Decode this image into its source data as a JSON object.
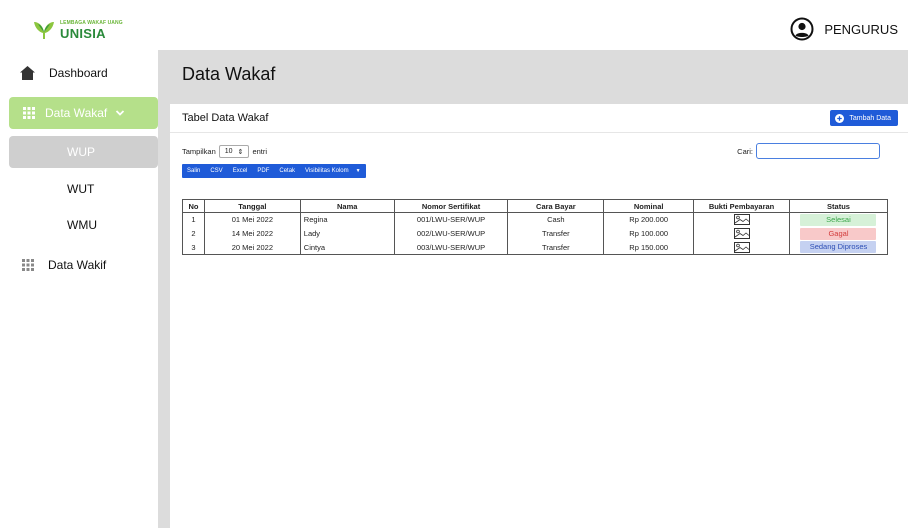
{
  "brand": {
    "line1": "LEMBAGA WAKAF UANG",
    "line2": "UNISIA"
  },
  "header": {
    "user_label": "PENGURUS"
  },
  "sidebar": {
    "items": [
      {
        "label": "Dashboard",
        "icon": "home-icon"
      },
      {
        "label": "Data Wakaf",
        "icon": "grid-icon"
      },
      {
        "label": "WUP"
      },
      {
        "label": "WUT"
      },
      {
        "label": "WMU"
      },
      {
        "label": "Data Wakif",
        "icon": "grid-icon"
      }
    ]
  },
  "main": {
    "page_title": "Data Wakaf",
    "card_title": "Tabel Data Wakaf",
    "add_button": "Tambah Data",
    "length": {
      "prefix": "Tampilkan",
      "value": "10",
      "suffix": "entri"
    },
    "search": {
      "label": "Cari:",
      "value": ""
    },
    "export_buttons": [
      "Salin",
      "CSV",
      "Excel",
      "PDF",
      "Cetak",
      "Visibilitas Kolom"
    ]
  },
  "table": {
    "headers": [
      "No",
      "Tanggal",
      "Nama",
      "Nomor Sertifikat",
      "Cara Bayar",
      "Nominal",
      "Bukti Pembayaran",
      "Status"
    ],
    "rows": [
      {
        "no": "1",
        "tanggal": "01 Mei 2022",
        "nama": "Regina",
        "nomor": "001/LWU-SER/WUP",
        "cara": "Cash",
        "nominal": "Rp 200.000",
        "status": "Selesai"
      },
      {
        "no": "2",
        "tanggal": "14 Mei 2022",
        "nama": "Lady",
        "nomor": "002/LWU-SER/WUP",
        "cara": "Transfer",
        "nominal": "Rp 100.000",
        "status": "Gagal"
      },
      {
        "no": "3",
        "tanggal": "20 Mei 2022",
        "nama": "Cintya",
        "nomor": "003/LWU-SER/WUP",
        "cara": "Transfer",
        "nominal": "Rp 150.000",
        "status": "Sedang Diproses"
      }
    ]
  },
  "colors": {
    "accent": "#1f5bd8",
    "sidebar_active": "#b5e08a",
    "sidebar_selected": "#cfcfcf",
    "status_done": "#3aa54a",
    "status_failed": "#d23c3c",
    "status_process": "#2e4fb5"
  }
}
